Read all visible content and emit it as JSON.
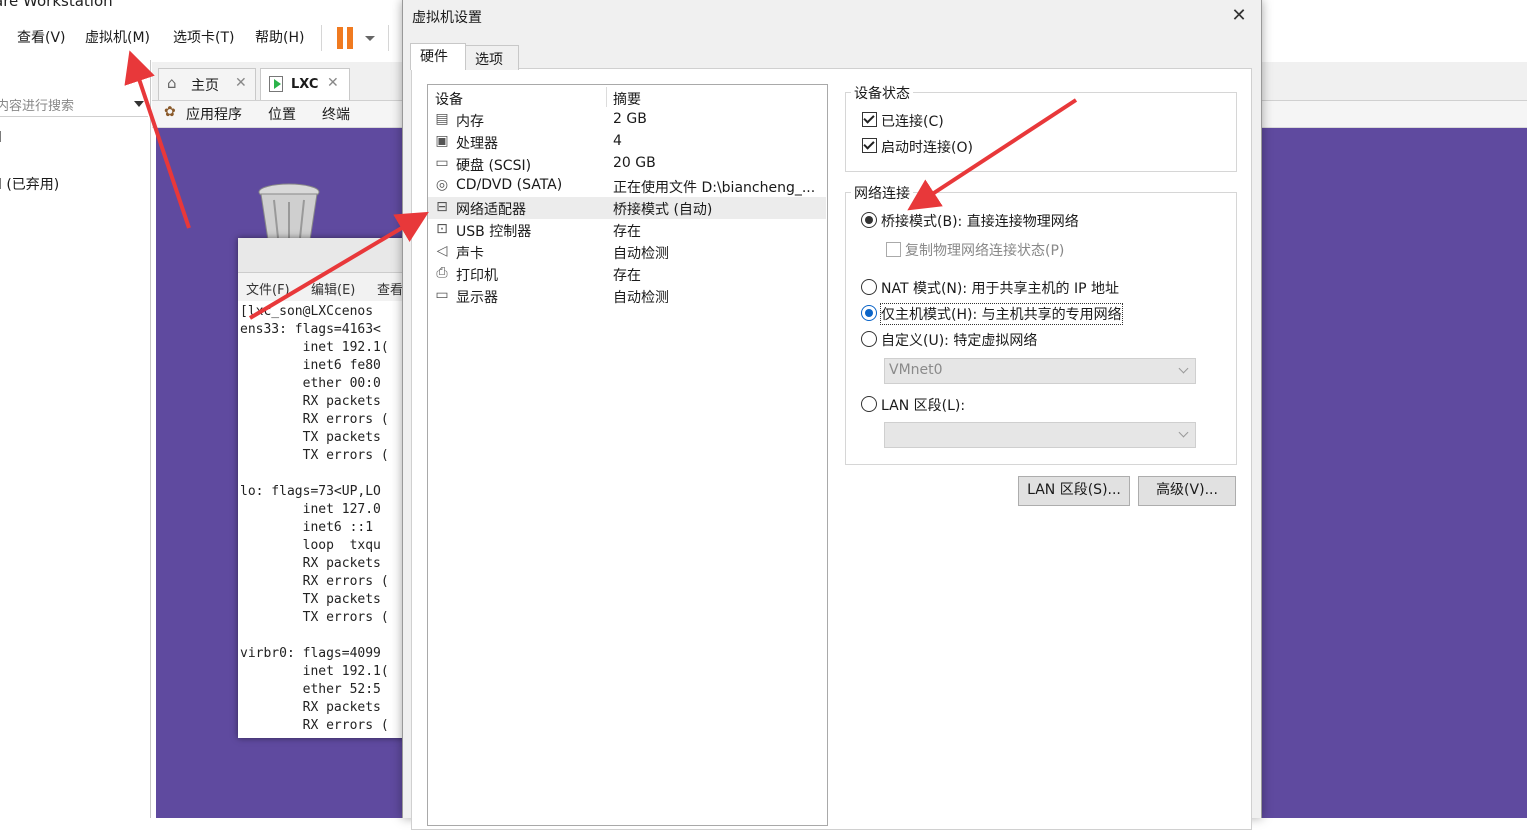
{
  "app": {
    "title_fragment": "are Workstation"
  },
  "menu": {
    "view": "查看(V)",
    "vm": "虚拟机(M)",
    "tabs": "选项卡(T)",
    "help": "帮助(H)"
  },
  "sidebar": {
    "search_placeholder": "内容进行搜索",
    "item1": "l",
    "item2": "l (已弃用)"
  },
  "tabs": {
    "home": "主页",
    "lxc": "LXC"
  },
  "vm_toolbar": {
    "apps": "应用程序",
    "places": "位置",
    "terminal": "终端"
  },
  "terminal": {
    "menu": {
      "file": "文件(F)",
      "edit": "编辑(E)",
      "view": "查看"
    },
    "lines": [
      "[lxc_son@LXCcenos",
      "ens33: flags=4163<",
      "        inet 192.1(",
      "        inet6 fe80",
      "        ether 00:0",
      "        RX packets",
      "        RX errors (",
      "        TX packets",
      "        TX errors (",
      "",
      "lo: flags=73<UP,LO",
      "        inet 127.0",
      "        inet6 ::1",
      "        loop  txqu",
      "        RX packets",
      "        RX errors (",
      "        TX packets",
      "        TX errors (",
      "",
      "virbr0: flags=4099",
      "        inet 192.1(",
      "        ether 52:5",
      "        RX packets",
      "        RX errors ("
    ]
  },
  "dialog": {
    "title": "虚拟机设置",
    "tab_hardware": "硬件",
    "tab_options": "选项",
    "col_device": "设备",
    "col_summary": "摘要",
    "devices": [
      {
        "name": "内存",
        "summary": "2 GB",
        "icon": "memory-icon"
      },
      {
        "name": "处理器",
        "summary": "4",
        "icon": "cpu-icon"
      },
      {
        "name": "硬盘 (SCSI)",
        "summary": "20 GB",
        "icon": "hard-disk-icon"
      },
      {
        "name": "CD/DVD (SATA)",
        "summary": "正在使用文件 D:\\biancheng_...",
        "icon": "cd-dvd-icon"
      },
      {
        "name": "网络适配器",
        "summary": "桥接模式 (自动)",
        "icon": "network-adapter-icon"
      },
      {
        "name": "USB 控制器",
        "summary": "存在",
        "icon": "usb-icon"
      },
      {
        "name": "声卡",
        "summary": "自动检测",
        "icon": "sound-card-icon"
      },
      {
        "name": "打印机",
        "summary": "存在",
        "icon": "printer-icon"
      },
      {
        "name": "显示器",
        "summary": "自动检测",
        "icon": "display-icon"
      }
    ],
    "device_status": {
      "label": "设备状态",
      "connected": "已连接(C)",
      "connect_on_power": "启动时连接(O)"
    },
    "network": {
      "label": "网络连接",
      "bridged": "桥接模式(B): 直接连接物理网络",
      "replicate": "复制物理网络连接状态(P)",
      "nat": "NAT 模式(N): 用于共享主机的 IP 地址",
      "host_only": "仅主机模式(H): 与主机共享的专用网络",
      "custom": "自定义(U): 特定虚拟网络",
      "custom_value": "VMnet0",
      "lan": "LAN 区段(L):",
      "lan_value": ""
    },
    "btn_lan_segments": "LAN 区段(S)...",
    "btn_advanced": "高级(V)..."
  },
  "colors": {
    "accent_orange": "#f07a20",
    "guest_bg": "#5f4a9f",
    "annotation_red": "#e8383a",
    "radio_blue": "#0a64c8"
  }
}
